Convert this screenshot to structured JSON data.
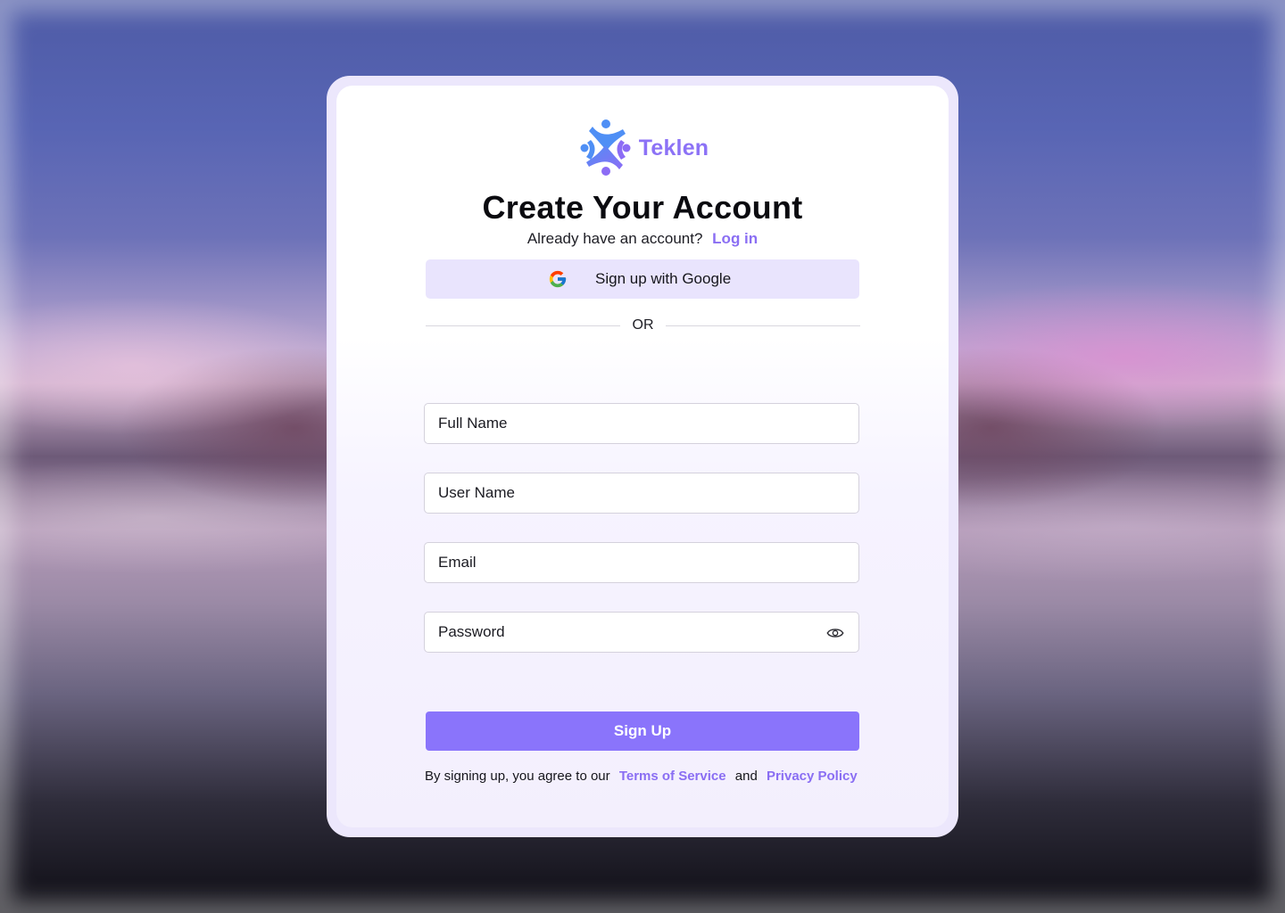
{
  "brand": {
    "name": "Teklen",
    "color": "#8c72f6",
    "logo_icon": "people-circle-logo-icon"
  },
  "header": {
    "title": "Create Your Account",
    "have_account_text": "Already have an account?",
    "login_link": "Log in"
  },
  "google": {
    "label": "Sign up with Google",
    "icon": "google-icon"
  },
  "divider": {
    "text": "OR"
  },
  "form": {
    "full_name": {
      "placeholder": "Full Name",
      "value": ""
    },
    "user_name": {
      "placeholder": "User Name",
      "value": ""
    },
    "email": {
      "placeholder": "Email",
      "value": ""
    },
    "password": {
      "placeholder": "Password",
      "value": "",
      "toggle_icon": "eye-icon"
    },
    "submit_label": "Sign Up"
  },
  "legal": {
    "prefix": "By signing up, you agree to our",
    "terms": "Terms of Service",
    "and": "and",
    "privacy": "Privacy Policy"
  },
  "colors": {
    "accent": "#8a74fb",
    "google_button_bg": "#e9e4fd",
    "card_frame": "#ece7fc"
  }
}
